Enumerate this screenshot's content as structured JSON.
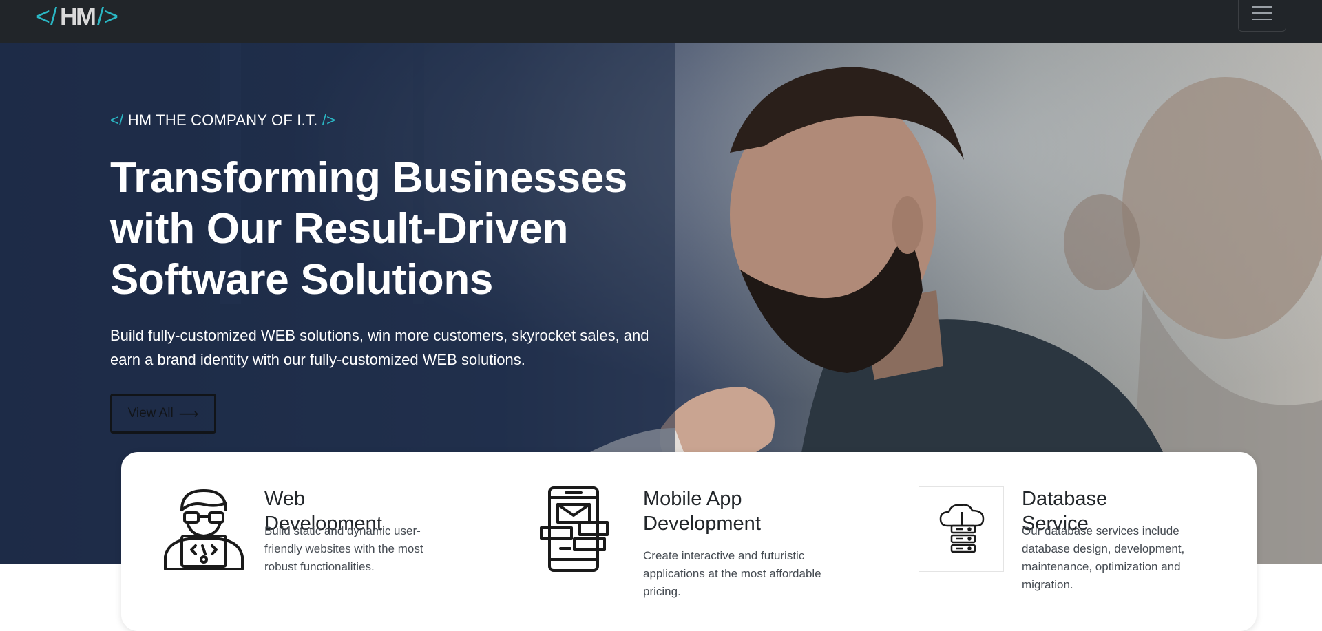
{
  "brand": {
    "logo_open": "</",
    "logo_text": "HM",
    "logo_close": "/>"
  },
  "nav": {
    "menu_icon": "hamburger-menu-icon"
  },
  "hero": {
    "eyebrow_open": "</",
    "eyebrow_text": "HM THE COMPANY OF I.T.",
    "eyebrow_close": "/>",
    "headline": "Transforming Businesses with Our Result-Driven Software Solutions",
    "subtext": "Build fully-customized WEB solutions, win more customers, skyrocket sales, and earn a brand identity with our fully-customized WEB solutions.",
    "cta_label": "View All",
    "cta_arrow": "⟶"
  },
  "services": [
    {
      "icon": "developer-laptop-icon",
      "title": "Web Development",
      "description": "Build static and dynamic user-friendly websites with the most robust functionalities."
    },
    {
      "icon": "mobile-app-icon",
      "title": "Mobile App Development",
      "description": "Create interactive and futuristic applications at the most affordable pricing."
    },
    {
      "icon": "cloud-database-icon",
      "title": "Database Service",
      "description": "Our database services include database design, development, maintenance, optimization and migration."
    }
  ],
  "colors": {
    "navbar": "#212529",
    "accent": "#2ab7c4",
    "hero_overlay": "#1e2b47",
    "text_dark": "#212529"
  }
}
